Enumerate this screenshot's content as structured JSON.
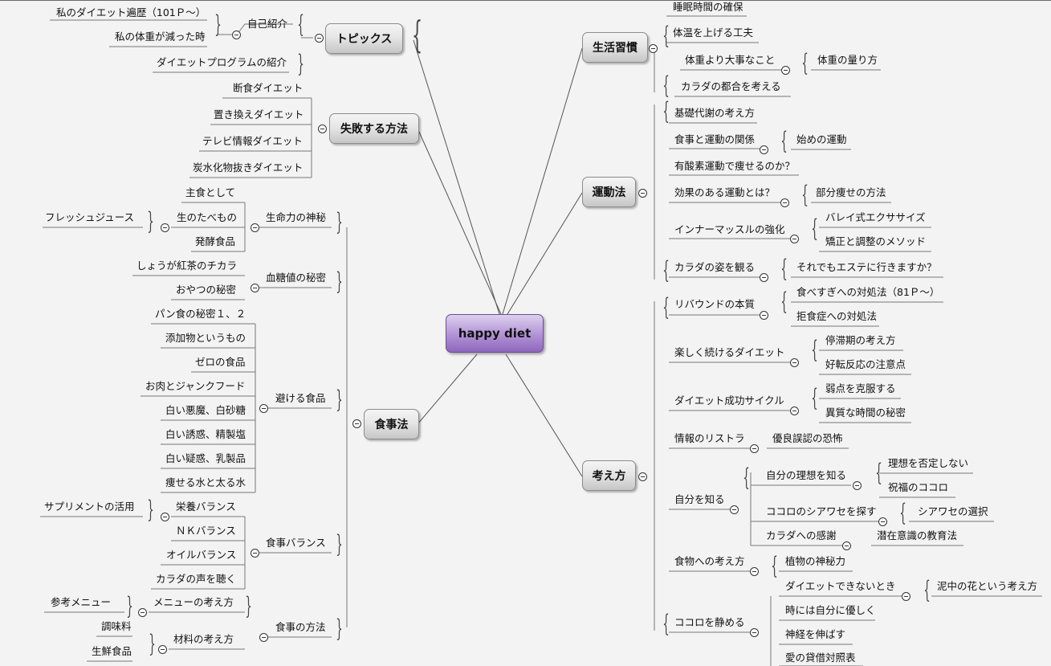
{
  "center": {
    "label": "happy diet"
  },
  "main": {
    "topics": "トピックス",
    "failure": "失敗する方法",
    "diet": "食事法",
    "habits": "生活習慣",
    "exercise": "運動法",
    "mindset": "考え方"
  },
  "topics": {
    "intro": "自己紹介",
    "history": "私のダイエット遍歴（101Ｐ～）",
    "weight": "私の体重が減った時",
    "program": "ダイエットプログラムの紹介"
  },
  "failure": {
    "items": [
      "断食ダイエット",
      "置き換えダイエット",
      "テレビ情報ダイエット",
      "炭水化物抜きダイエット"
    ]
  },
  "diet": {
    "life": "生命力の神秘",
    "staple": "主食として",
    "rawfood": "生のたべもの",
    "ferment": "発酵食品",
    "juice": "フレッシュジュース",
    "sugar": "血糖値の秘密",
    "ginger": "しょうが紅茶のチカラ",
    "snack": "おやつの秘密",
    "avoid": "避ける食品",
    "avoid_items": [
      "パン食の秘密１、２",
      "添加物というもの",
      "ゼロの食品",
      "お肉とジャンクフード",
      "白い悪魔、白砂糖",
      "白い誘惑、精製塩",
      "白い疑惑、乳製品",
      "痩せる水と太る水"
    ],
    "balance": "食事バランス",
    "nutrition": "栄養バランス",
    "supplement": "サプリメントの活用",
    "nk": "ＮＫバランス",
    "oil": "オイルバランス",
    "voice": "カラダの声を聴く",
    "method": "食事の方法",
    "menu": "メニューの考え方",
    "menu_ref": "参考メニュー",
    "ingredients": "材料の考え方",
    "seasoning": "調味料",
    "fresh": "生鮮食品"
  },
  "habits": {
    "sleep": "睡眠時間の確保",
    "temp": "体温を上げる工夫",
    "more": "体重より大事なこと",
    "measure": "体重の量り方",
    "body": "カラダの都合を考える"
  },
  "exercise": {
    "bmr": "基礎代謝の考え方",
    "relation": "食事と運動の関係",
    "start": "始めの運動",
    "aerobic": "有酸素運動で痩せるのか？",
    "effective": "効果のある運動とは？",
    "partial": "部分痩せの方法",
    "inner": "インナーマッスルの強化",
    "ballet": "バレイ式エクササイズ",
    "correct": "矯正と調整のメソッド",
    "figure": "カラダの姿を観る",
    "esthe": "それでもエステに行きますか？"
  },
  "mindset": {
    "rebound": "リバウンドの本質",
    "overeat": "食べすぎへの対処法（81Ｐ～）",
    "refuse": "拒食症への対処法",
    "enjoy": "楽しく続けるダイエット",
    "plateau": "停滞期の考え方",
    "good": "好転反応の注意点",
    "cycle": "ダイエット成功サイクル",
    "weak": "弱点を克服する",
    "special": "異質な時間の秘密",
    "info": "情報のリストラ",
    "fear": "優良誤認の恐怖",
    "self": "自分を知る",
    "ideal": "自分の理想を知る",
    "nodeny": "理想を否定しない",
    "bless": "祝福のココロ",
    "happy": "ココロのシアワセを探す",
    "choice": "シアワセの選択",
    "thanks": "カラダへの感謝",
    "subcon": "潜在意識の教育法",
    "foodthink": "食物への考え方",
    "plant": "植物の神秘力",
    "calm": "ココロを静める",
    "cant": "ダイエットできないとき",
    "lotus": "泥中の花という考え方",
    "kind": "時には自分に優しく",
    "nerve": "神経を伸ばす",
    "love": "愛の貸借対照表"
  }
}
